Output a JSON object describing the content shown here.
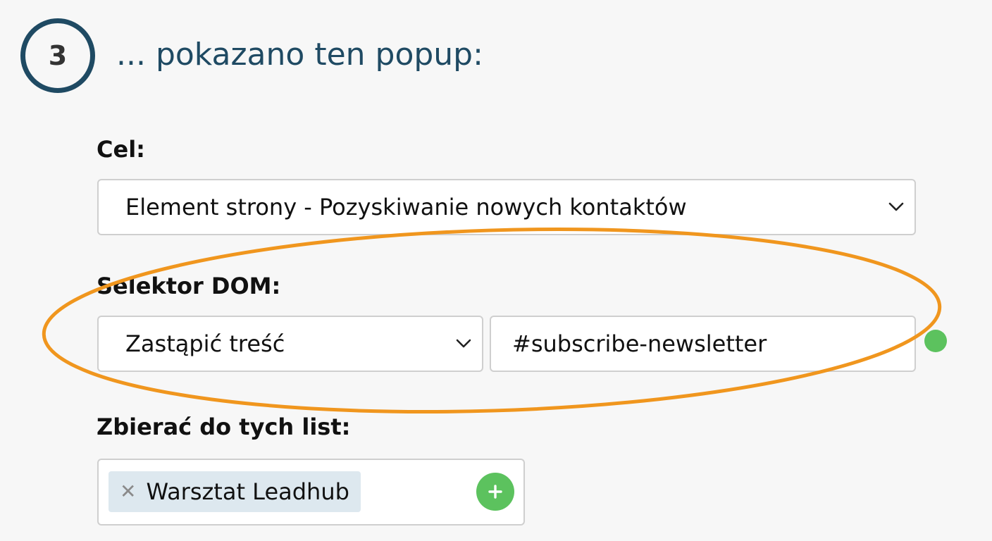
{
  "step": {
    "number": "3",
    "title": "... pokazano ten popup:"
  },
  "goal": {
    "label": "Cel:",
    "selected": "Element strony - Pozyskiwanie nowych kontaktów"
  },
  "dom_selector": {
    "label": "Selektor DOM:",
    "mode_selected": "Zastąpić treść",
    "selector_value": "#subscribe-newsletter"
  },
  "lists": {
    "label": "Zbierać do tych list:",
    "tags": [
      "Warsztat Leadhub"
    ]
  },
  "colors": {
    "primary": "#1f4a63",
    "accent_green": "#5cc25e",
    "highlight_orange": "#f0961e",
    "tag_background": "#dde8ef"
  },
  "icons": {
    "select_arrow": "chevron-down-icon",
    "tag_remove": "close-icon",
    "add_list": "plus-icon",
    "info": "info-icon"
  }
}
